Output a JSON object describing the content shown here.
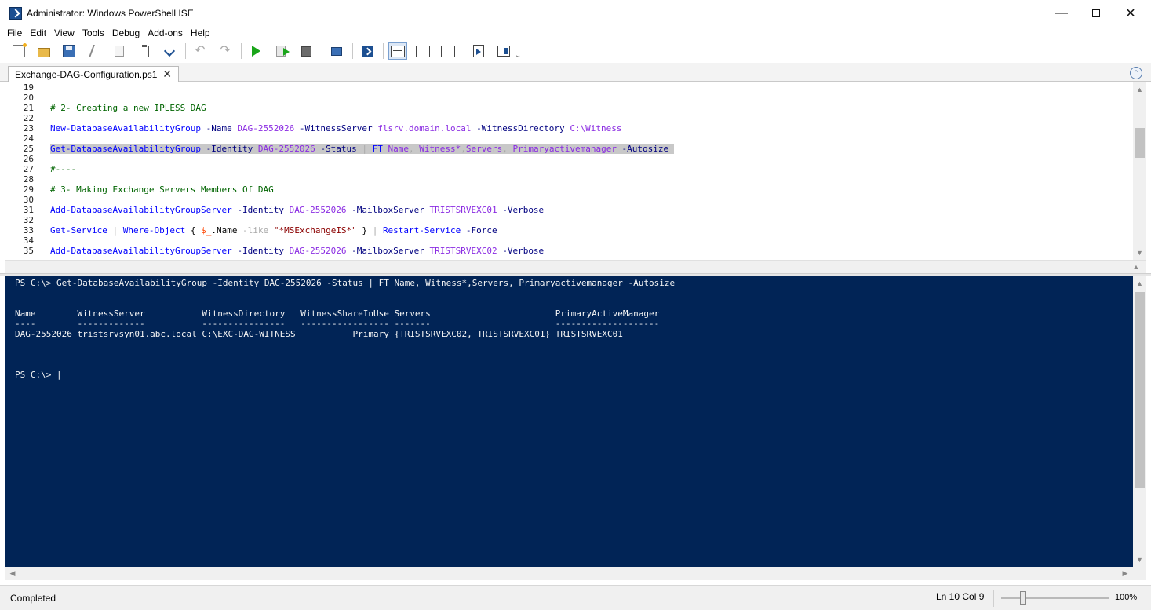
{
  "window": {
    "title": "Administrator: Windows PowerShell ISE",
    "minimize": "—",
    "close": "✕"
  },
  "menu": [
    "File",
    "Edit",
    "View",
    "Tools",
    "Debug",
    "Add-ons",
    "Help"
  ],
  "toolbar": {
    "icons": [
      "new-script-icon",
      "open-icon",
      "save-icon",
      "cut-icon",
      "copy-icon",
      "paste-icon",
      "snippet-icon",
      "undo-icon",
      "redo-icon",
      "run-script-icon",
      "run-selection-icon",
      "stop-icon",
      "remote-powershell-icon",
      "powershell-console-icon",
      "layout-top-icon",
      "layout-right-icon",
      "layout-maximize-icon",
      "show-script-pane-icon",
      "command-addon-icon"
    ],
    "undo_glyph": "↶",
    "redo_glyph": "↷",
    "overflow_glyph": "⌄"
  },
  "tab": {
    "label": "Exchange-DAG-Configuration.ps1",
    "close": "✕",
    "collapse_glyph": "⌃"
  },
  "script": {
    "lines": [
      {
        "n": "19",
        "tokens": []
      },
      {
        "n": "20",
        "tokens": []
      },
      {
        "n": "21",
        "tokens": [
          {
            "c": "c-comment",
            "t": "# 2- Creating a new IPLESS DAG"
          }
        ]
      },
      {
        "n": "22",
        "tokens": []
      },
      {
        "n": "23",
        "tokens": [
          {
            "c": "c-cmd",
            "t": "New-DatabaseAvailabilityGroup"
          },
          {
            "c": "c-param",
            "t": " -Name "
          },
          {
            "c": "c-arg",
            "t": "DAG-2552026"
          },
          {
            "c": "c-param",
            "t": " -WitnessServer "
          },
          {
            "c": "c-arg",
            "t": "flsrv.domain.local"
          },
          {
            "c": "c-param",
            "t": " -WitnessDirectory "
          },
          {
            "c": "c-arg",
            "t": "C:\\Witness"
          }
        ]
      },
      {
        "n": "24",
        "tokens": []
      },
      {
        "n": "25",
        "sel": true,
        "tokens": [
          {
            "c": "c-cmd",
            "t": "Get-DatabaseAvailabilityGroup"
          },
          {
            "c": "c-param",
            "t": " -Identity "
          },
          {
            "c": "c-arg",
            "t": "DAG-2552026"
          },
          {
            "c": "c-param",
            "t": " -Status "
          },
          {
            "c": "c-op",
            "t": "| "
          },
          {
            "c": "c-cmd",
            "t": "FT"
          },
          {
            "c": "c-arg",
            "t": " Name"
          },
          {
            "c": "c-op",
            "t": ", "
          },
          {
            "c": "c-arg",
            "t": "Witness*"
          },
          {
            "c": "c-op",
            "t": ","
          },
          {
            "c": "c-arg",
            "t": "Servers"
          },
          {
            "c": "c-op",
            "t": ", "
          },
          {
            "c": "c-arg",
            "t": "Primaryactivemanager"
          },
          {
            "c": "c-param",
            "t": " -Autosize "
          }
        ]
      },
      {
        "n": "26",
        "tokens": []
      },
      {
        "n": "27",
        "tokens": [
          {
            "c": "c-comment",
            "t": "#----"
          }
        ]
      },
      {
        "n": "28",
        "tokens": []
      },
      {
        "n": "29",
        "tokens": [
          {
            "c": "c-comment",
            "t": "# 3- Making Exchange Servers Members Of DAG"
          }
        ]
      },
      {
        "n": "30",
        "tokens": []
      },
      {
        "n": "31",
        "tokens": [
          {
            "c": "c-cmd",
            "t": "Add-DatabaseAvailabilityGroupServer"
          },
          {
            "c": "c-param",
            "t": " -Identity "
          },
          {
            "c": "c-arg",
            "t": "DAG-2552026"
          },
          {
            "c": "c-param",
            "t": " -MailboxServer "
          },
          {
            "c": "c-arg",
            "t": "TRISTSRVEXC01"
          },
          {
            "c": "c-param",
            "t": " -Verbose"
          }
        ]
      },
      {
        "n": "32",
        "tokens": []
      },
      {
        "n": "33",
        "tokens": [
          {
            "c": "c-cmd",
            "t": "Get-Service"
          },
          {
            "c": "c-op",
            "t": " | "
          },
          {
            "c": "c-cmd",
            "t": "Where-Object"
          },
          {
            "c": "c-plain",
            "t": " { "
          },
          {
            "c": "c-var",
            "t": "$_"
          },
          {
            "c": "c-plain",
            "t": ".Name "
          },
          {
            "c": "c-op",
            "t": "-like"
          },
          {
            "c": "c-plain",
            "t": " "
          },
          {
            "c": "c-str",
            "t": "\"*MSExchangeIS*\""
          },
          {
            "c": "c-plain",
            "t": " } "
          },
          {
            "c": "c-op",
            "t": "| "
          },
          {
            "c": "c-cmd",
            "t": "Restart-Service"
          },
          {
            "c": "c-param",
            "t": " -Force"
          }
        ]
      },
      {
        "n": "34",
        "tokens": []
      },
      {
        "n": "35",
        "tokens": [
          {
            "c": "c-cmd",
            "t": "Add-DatabaseAvailabilityGroupServer"
          },
          {
            "c": "c-param",
            "t": " -Identity "
          },
          {
            "c": "c-arg",
            "t": "DAG-2552026"
          },
          {
            "c": "c-param",
            "t": " -MailboxServer "
          },
          {
            "c": "c-arg",
            "t": "TRISTSRVEXC02"
          },
          {
            "c": "c-param",
            "t": " -Verbose"
          }
        ]
      }
    ]
  },
  "console": {
    "lines": [
      "PS C:\\> Get-DatabaseAvailabilityGroup -Identity DAG-2552026 -Status | FT Name, Witness*,Servers, Primaryactivemanager -Autosize",
      "",
      "",
      "Name        WitnessServer           WitnessDirectory   WitnessShareInUse Servers                        PrimaryActiveManager",
      "----        -------------           ----------------   ----------------- -------                        --------------------",
      "DAG-2552026 tristsrvsyn01.abc.local C:\\EXC-DAG-WITNESS           Primary {TRISTSRVEXC02, TRISTSRVEXC01} TRISTSRVEXC01",
      "",
      "",
      "",
      "PS C:\\> |"
    ]
  },
  "status": {
    "text": "Completed",
    "position": "Ln 10  Col 9",
    "zoom": "100%",
    "zoom_level_percent": 100
  }
}
